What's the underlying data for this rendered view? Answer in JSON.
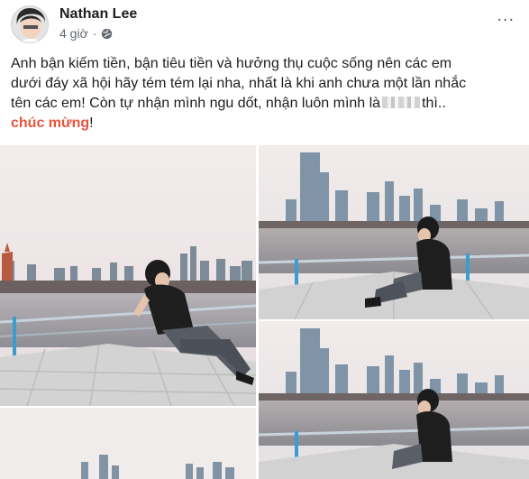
{
  "post": {
    "author": "Nathan Lee",
    "time": "4 giờ",
    "separator": "·",
    "more": "...",
    "text_line_1": "Anh bận kiếm tiền, bận tiêu tiền và hưởng thụ cuộc sống nên các em",
    "text_line_2": "dưới đáy xã hội hãy tém tém lại nha, nhất là khi anh chưa một lần nhắc",
    "text_line_3a": "tên các em! Còn tự nhận mình ngu dốt, nhận luôn mình là",
    "text_line_3b": "thì..",
    "highlight": "chúc mừng",
    "text_end": "!"
  },
  "colors": {
    "highlight": "#e9543d",
    "meta": "#606770"
  },
  "icons": {
    "globe": "globe-icon",
    "more": "more-options-icon"
  }
}
